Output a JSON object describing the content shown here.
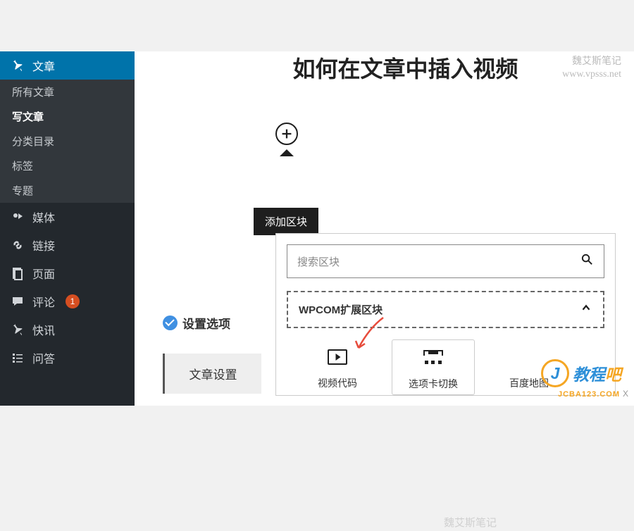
{
  "watermark": {
    "name": "魏艾斯笔记",
    "url": "www.vpsss.net"
  },
  "sidebar": {
    "posts": "文章",
    "submenu": {
      "all": "所有文章",
      "new": "写文章",
      "categories": "分类目录",
      "tags": "标签",
      "topics": "专题"
    },
    "media": "媒体",
    "links": "链接",
    "pages": "页面",
    "comments": "评论",
    "comments_count": "1",
    "news": "快讯",
    "faq": "问答"
  },
  "title": "如何在文章中插入视频",
  "tooltip": "添加区块",
  "settings": {
    "header": "设置选项",
    "tab": "文章设置"
  },
  "panel": {
    "search_placeholder": "搜索区块",
    "category": "WPCOM扩展区块",
    "blocks": {
      "video": "视频代码",
      "tabs": "选项卡切换",
      "map": "百度地图"
    }
  },
  "logo": {
    "cn": "教程吧",
    "domain": "JCBA123.COM"
  }
}
